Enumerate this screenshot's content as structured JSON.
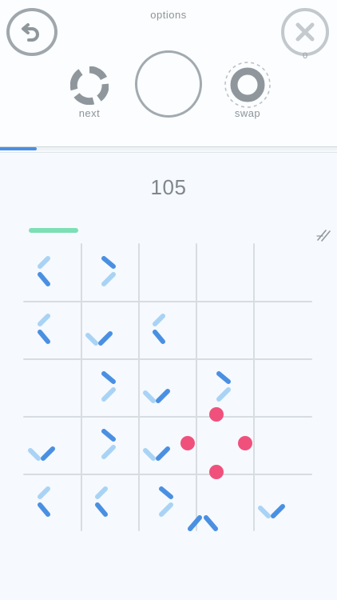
{
  "header": {
    "title": "options",
    "next_label": "next",
    "swap_label": "swap",
    "close_count": "0"
  },
  "progress": {
    "fraction": 0.11
  },
  "score": "105",
  "board": {
    "cols": 5,
    "rows": 5,
    "pieces": [
      [
        0,
        0,
        "lt"
      ],
      [
        1,
        0,
        "gt"
      ],
      [
        0,
        1,
        "lt"
      ],
      [
        1,
        1,
        "v"
      ],
      [
        2,
        1,
        "lt"
      ],
      [
        1,
        2,
        "gt"
      ],
      [
        2,
        2,
        "v"
      ],
      [
        3,
        2,
        "gt"
      ],
      [
        0,
        3,
        "v"
      ],
      [
        1,
        3,
        "gt"
      ],
      [
        2,
        3,
        "v"
      ],
      [
        0,
        4,
        "lt"
      ],
      [
        1,
        4,
        "lt"
      ],
      [
        2,
        4,
        "gt"
      ],
      [
        3,
        4,
        "caret"
      ],
      [
        4,
        4,
        "v"
      ]
    ],
    "dots": [
      {
        "gx": 3.5,
        "gy": 3.0
      },
      {
        "gx": 3.0,
        "gy": 3.5
      },
      {
        "gx": 4.0,
        "gy": 3.5
      },
      {
        "gx": 3.5,
        "gy": 4.0
      }
    ]
  },
  "colors": {
    "dark_segment": "#4a90e2",
    "light_segment": "#a9d3f5",
    "dot": "#f0517c",
    "grid": "#d7dde2",
    "accent_green": "#7ddfb6"
  },
  "icons": {
    "undo": "undo-arrow-icon",
    "close": "close-x-icon",
    "next": "ring-segments-icon",
    "swap": "ring-dashed-icon",
    "hide": "slash-lines-icon"
  }
}
